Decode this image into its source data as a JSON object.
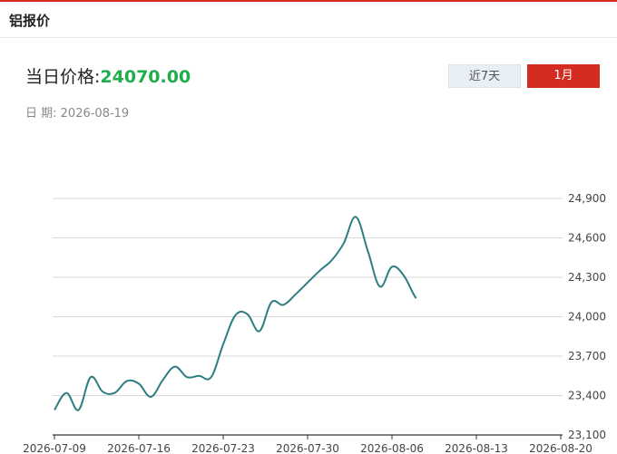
{
  "header": {
    "title": "铝报价"
  },
  "price": {
    "label": "当日价格:",
    "value": "24070.00"
  },
  "date": {
    "label": "日 期:",
    "value": "2026-08-19"
  },
  "buttons": {
    "week": "近7天",
    "month": "1月"
  },
  "colors": {
    "accent": "#d42c21",
    "price": "#1fae4b",
    "line": "#2e7d82"
  },
  "chart_data": {
    "type": "line",
    "x": [
      "2026-07-09",
      "2026-07-10",
      "2026-07-11",
      "2026-07-12",
      "2026-07-13",
      "2026-07-14",
      "2026-07-15",
      "2026-07-16",
      "2026-07-17",
      "2026-07-18",
      "2026-07-19",
      "2026-07-20",
      "2026-07-21",
      "2026-07-22",
      "2026-07-23",
      "2026-07-24",
      "2026-07-25",
      "2026-07-26",
      "2026-07-27",
      "2026-07-28",
      "2026-07-29",
      "2026-07-30",
      "2026-07-31",
      "2026-08-01",
      "2026-08-02",
      "2026-08-03",
      "2026-08-04",
      "2026-08-05",
      "2026-08-06",
      "2026-08-07",
      "2026-08-08",
      "2026-08-09",
      "2026-08-10",
      "2026-08-11",
      "2026-08-12",
      "2026-08-13",
      "2026-08-14",
      "2026-08-15",
      "2026-08-16",
      "2026-08-17",
      "2026-08-18",
      "2026-08-19"
    ],
    "values": [
      23290,
      23420,
      23290,
      23540,
      23430,
      23420,
      23510,
      23490,
      23390,
      23520,
      23620,
      23540,
      23550,
      23540,
      23790,
      24010,
      24020,
      23890,
      24110,
      24090,
      24170,
      24260,
      24350,
      24430,
      24560,
      24760,
      24500,
      24230,
      24380,
      24310,
      24140,
      24070
    ],
    "xticks": [
      "2026-07-09",
      "2026-07-16",
      "2026-07-23",
      "2026-07-30",
      "2026-08-06",
      "2026-08-13",
      "2026-08-20"
    ],
    "yticks": [
      "23,100",
      "23,400",
      "23,700",
      "24,000",
      "24,300",
      "24,600",
      "24,900"
    ],
    "ylim": [
      23100,
      24900
    ],
    "grid": true
  }
}
